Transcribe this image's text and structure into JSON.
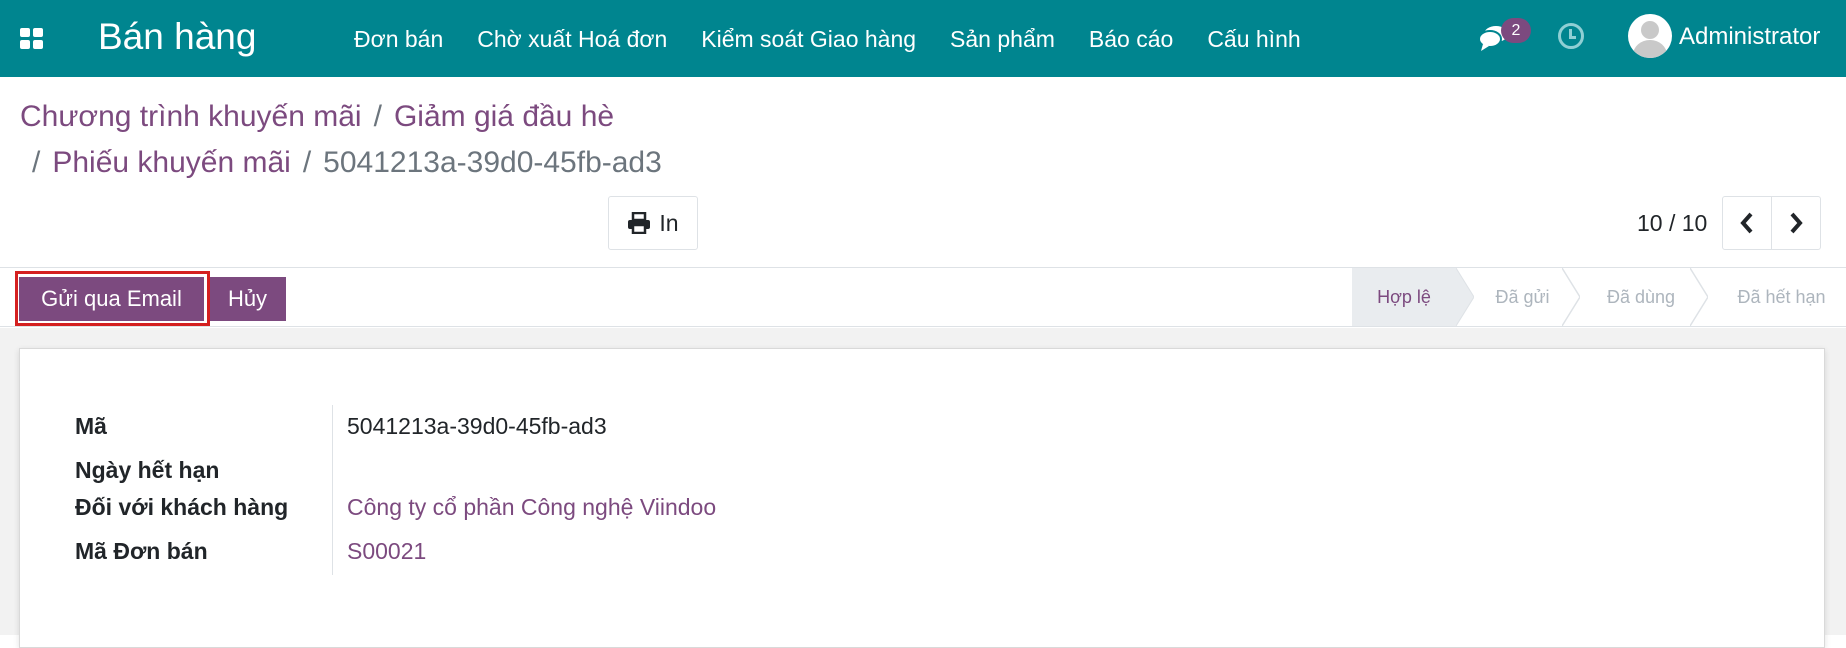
{
  "navbar": {
    "app_title": "Bán hàng",
    "menu": [
      "Đơn bán",
      "Chờ xuất Hoá đơn",
      "Kiểm soát Giao hàng",
      "Sản phẩm",
      "Báo cáo",
      "Cấu hình"
    ],
    "chat_count": "2",
    "user_name": "Administrator",
    "color": "#00858f"
  },
  "breadcrumb": {
    "item1": "Chương trình khuyến mãi",
    "item2": "Giảm giá đầu hè",
    "item3": "Phiếu khuyến mãi",
    "current": "5041213a-39d0-45fb-ad3",
    "separator": "/"
  },
  "actions": {
    "print_label": "In"
  },
  "pager": {
    "value": "10 / 10"
  },
  "statusbar": {
    "send_email_label": "Gửi qua Email",
    "cancel_label": "Hủy",
    "stages": [
      "Hợp lệ",
      "Đã gửi",
      "Đã dùng",
      "Đã hết hạn"
    ],
    "active_stage": "Hợp lệ",
    "accent": "#7c4a7f"
  },
  "form": {
    "code_label": "Mã",
    "code_value": "5041213a-39d0-45fb-ad3",
    "expiry_label": "Ngày hết hạn",
    "expiry_value": "",
    "customer_label": "Đối với khách hàng",
    "customer_value": "Công ty cổ phần Công nghệ Viindoo",
    "order_label": "Mã Đơn bán",
    "order_value": "S00021"
  }
}
